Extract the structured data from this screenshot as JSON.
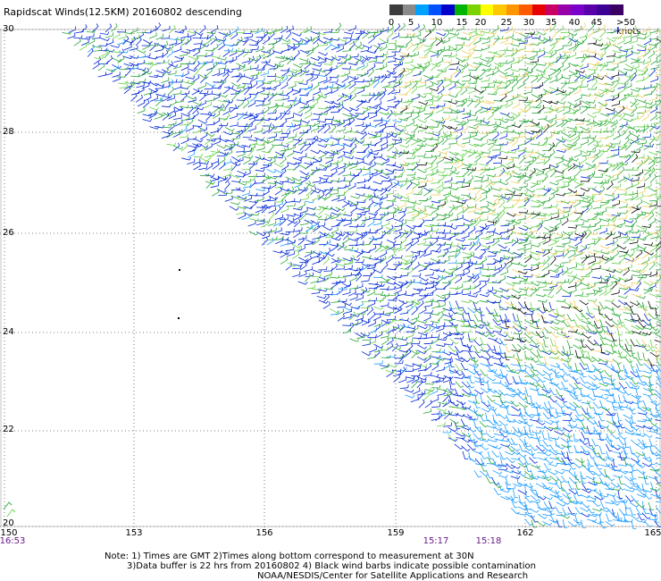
{
  "title": "Rapidscat Winds(12.5KM) 20160802 descending",
  "legend": {
    "labels": [
      "0",
      "5",
      "10",
      "15",
      "20",
      "25",
      "30",
      "35",
      "40",
      "45",
      ">50 knots"
    ],
    "colors": [
      "#3c3c3c",
      "#8a8a8a",
      "#00a0ff",
      "#0050ff",
      "#0000c8",
      "#00b400",
      "#7cd200",
      "#ffff00",
      "#ffc800",
      "#ff9600",
      "#ff5a00",
      "#e60000",
      "#c80064",
      "#9600aa",
      "#7800c8",
      "#5a00aa",
      "#3c0096",
      "#3c0064"
    ]
  },
  "axes": {
    "lat_labels": [
      "30",
      "28",
      "26",
      "24",
      "22",
      "20"
    ],
    "lon_labels": [
      "150",
      "153",
      "156",
      "159",
      "162",
      "165"
    ]
  },
  "times": [
    "16:53",
    "15:17",
    "15:18"
  ],
  "notes": {
    "line1": "Note: 1) Times are GMT 2)Times along bottom correspond to measurement at 30N",
    "line2": "3)Data buffer is 22 hrs from 20160802 4) Black wind barbs indicate possible contamination",
    "line3": "NOAA/NESDIS/Center for Satellite Applications and Research"
  },
  "wind_colors": {
    "blue": "#0026d6",
    "lightblue": "#1a9cff",
    "green": "#2aa83a",
    "lightgreen": "#66d24a",
    "yellow": "#f0d060",
    "black": "#101010"
  }
}
